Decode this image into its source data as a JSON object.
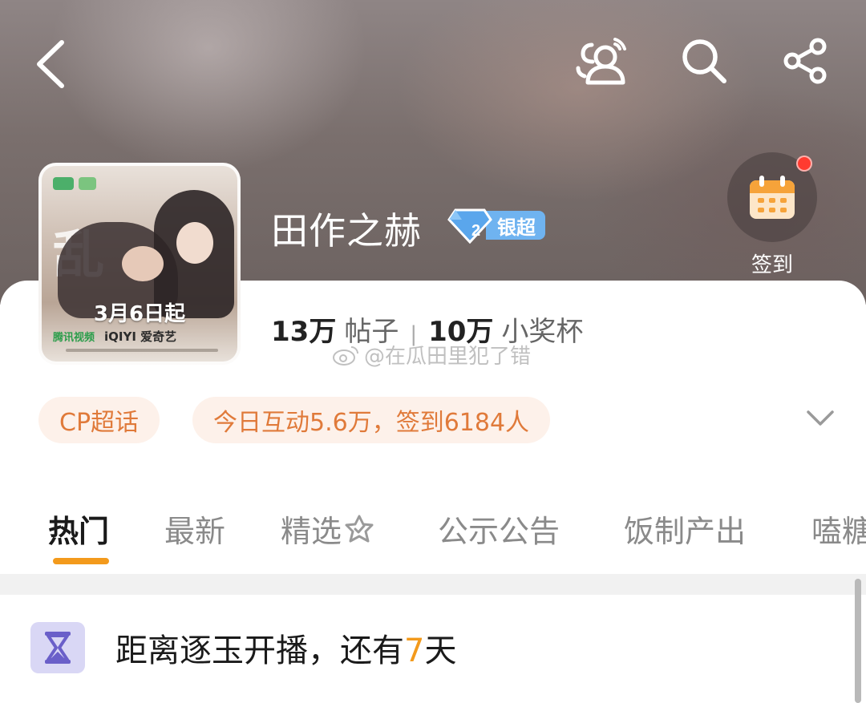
{
  "header": {
    "back_icon": "chevron-left-icon",
    "people_icon": "people-group-icon",
    "search_icon": "search-icon",
    "share_icon": "share-icon"
  },
  "topic": {
    "title": "田作之赫",
    "level": {
      "number": "2",
      "label": "银超"
    },
    "poster": {
      "date_text": "3月6日起",
      "logos": [
        "腾讯视频",
        "iQIYI 爱奇艺"
      ]
    },
    "signin": {
      "label": "签到",
      "has_notification": true
    },
    "stats": {
      "posts_value": "13万",
      "posts_label": "帖子",
      "cups_value": "10万",
      "cups_label": "小奖杯"
    },
    "watermark": "@在瓜田里犯了错"
  },
  "pills": {
    "category": "CP超话",
    "activity": "今日互动5.6万，签到6184人"
  },
  "tabs": [
    {
      "label": "热门",
      "active": true
    },
    {
      "label": "最新",
      "active": false
    },
    {
      "label": "精选",
      "active": false
    },
    {
      "label": "公示公告",
      "active": false
    },
    {
      "label": "饭制产出",
      "active": false
    },
    {
      "label": "嗑糖",
      "active": false
    }
  ],
  "countdown": {
    "prefix": "距离逐玉开播，还有",
    "days": "7",
    "suffix": "天"
  },
  "colors": {
    "accent": "#f39a1c",
    "pill_text": "#e07a3a",
    "pill_bg": "#fdf1ea",
    "badge_blue": "#6fb3f0",
    "notification_red": "#ff3b30"
  }
}
